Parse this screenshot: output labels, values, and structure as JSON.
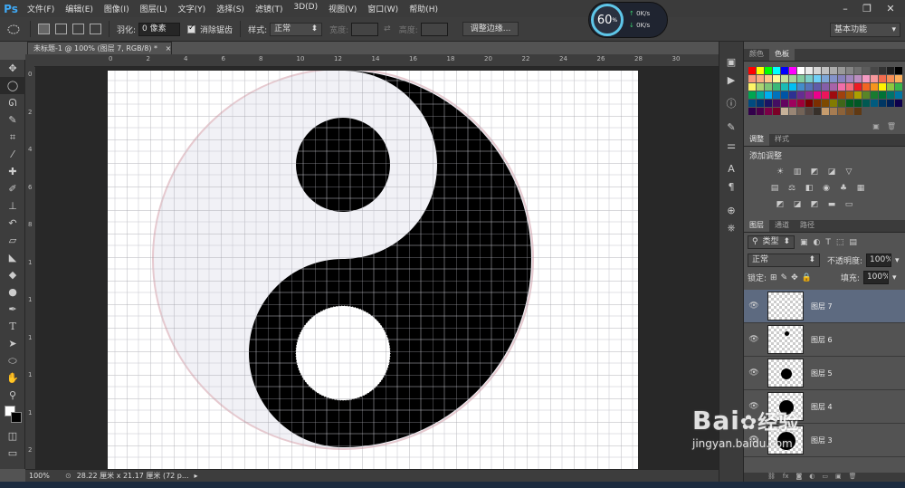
{
  "app": {
    "logo": "Ps"
  },
  "menus": [
    "文件(F)",
    "编辑(E)",
    "图像(I)",
    "图层(L)",
    "文字(Y)",
    "选择(S)",
    "滤镜(T)",
    "3D(D)",
    "视图(V)",
    "窗口(W)",
    "帮助(H)"
  ],
  "options": {
    "feather_label": "羽化:",
    "feather_value": "0 像素",
    "antialias_label": "消除锯齿",
    "style_label": "样式:",
    "style_value": "正常",
    "width_label": "宽度:",
    "height_label": "高度:",
    "refine_button": "调整边缘..."
  },
  "workspace": "基本功能",
  "gauge": {
    "percent": "60",
    "unit": "%",
    "up": "0K/s",
    "down": "0K/s"
  },
  "document": {
    "tab_title": "未标题-1 @ 100% (图层 7, RGB/8) *",
    "close_icon": "×"
  },
  "ruler": {
    "top": [
      "0",
      "2",
      "4",
      "6",
      "8",
      "10",
      "12",
      "14",
      "16",
      "18",
      "20",
      "22",
      "24",
      "26",
      "28",
      "30"
    ],
    "left": [
      "0",
      "2",
      "4",
      "6",
      "8",
      "1",
      "1",
      "1",
      "1",
      "1",
      "2"
    ]
  },
  "status": {
    "zoom": "100%",
    "doc_info": "28.22 厘米 x 21.17 厘米 (72 p..."
  },
  "color_panel": {
    "tab_color": "颜色",
    "tab_swatches": "色板"
  },
  "swatches": [
    "#ff0000",
    "#ffff00",
    "#00ff00",
    "#00ffff",
    "#0000ff",
    "#ff00ff",
    "#ffffff",
    "#ebebeb",
    "#d6d6d6",
    "#c2c2c2",
    "#adadad",
    "#999999",
    "#858585",
    "#707070",
    "#5c5c5c",
    "#474747",
    "#333333",
    "#1f1f1f",
    "#000000",
    "#f7977a",
    "#f9ad81",
    "#fdc68a",
    "#fff79a",
    "#c4df9b",
    "#a3d39c",
    "#82ca9d",
    "#7bcdc8",
    "#6ecff6",
    "#7ea7d8",
    "#8493ca",
    "#8882be",
    "#a187be",
    "#bc8dbf",
    "#f49ac2",
    "#f6989d",
    "#f26c4f",
    "#f68e55",
    "#fbaf5c",
    "#fff467",
    "#acd372",
    "#7cc576",
    "#3bb878",
    "#1abbb4",
    "#00bff3",
    "#438cca",
    "#5574b9",
    "#605ca8",
    "#855fa8",
    "#a763a8",
    "#f06ea9",
    "#f26d7d",
    "#ed1c24",
    "#f26522",
    "#f7941d",
    "#fff200",
    "#8dc73f",
    "#39b54a",
    "#00a651",
    "#00a99d",
    "#00aeef",
    "#0072bc",
    "#0054a6",
    "#2e3192",
    "#662d91",
    "#92278f",
    "#ec008c",
    "#ed145b",
    "#9e0b0f",
    "#a0410d",
    "#a36209",
    "#aba000",
    "#598527",
    "#197b30",
    "#007236",
    "#00746b",
    "#0076a3",
    "#004b80",
    "#003471",
    "#1b1464",
    "#440e62",
    "#630460",
    "#9e005d",
    "#9e0039",
    "#790000",
    "#7b2e00",
    "#7d4900",
    "#827b00",
    "#406618",
    "#005e20",
    "#005826",
    "#005952",
    "#005b7f",
    "#003663",
    "#002157",
    "#0d004c",
    "#32004b",
    "#4b0049",
    "#7b0046",
    "#7a0026",
    "#c7b299",
    "#998675",
    "#736357",
    "#534741",
    "#37302a",
    "#c69c6d",
    "#a67c52",
    "#8c6239",
    "#754c24",
    "#603913"
  ],
  "adjust_panel": {
    "tab_adjust": "调整",
    "tab_styles": "样式",
    "title": "添加调整"
  },
  "layers_panel": {
    "tab_layers": "图层",
    "tab_channels": "通道",
    "tab_paths": "路径",
    "filter_label": "类型",
    "blend_mode": "正常",
    "opacity_label": "不透明度:",
    "opacity_value": "100%",
    "lock_label": "锁定:",
    "fill_label": "填充:",
    "fill_value": "100%",
    "layers": [
      {
        "name": "图层 7",
        "selected": true
      },
      {
        "name": "图层 6",
        "selected": false
      },
      {
        "name": "图层 5",
        "selected": false
      },
      {
        "name": "图层 4",
        "selected": false
      },
      {
        "name": "图层 3",
        "selected": false
      }
    ]
  },
  "watermark": {
    "brand": "Bai",
    "brand2": "经验",
    "url": "jingyan.baidu.com"
  }
}
